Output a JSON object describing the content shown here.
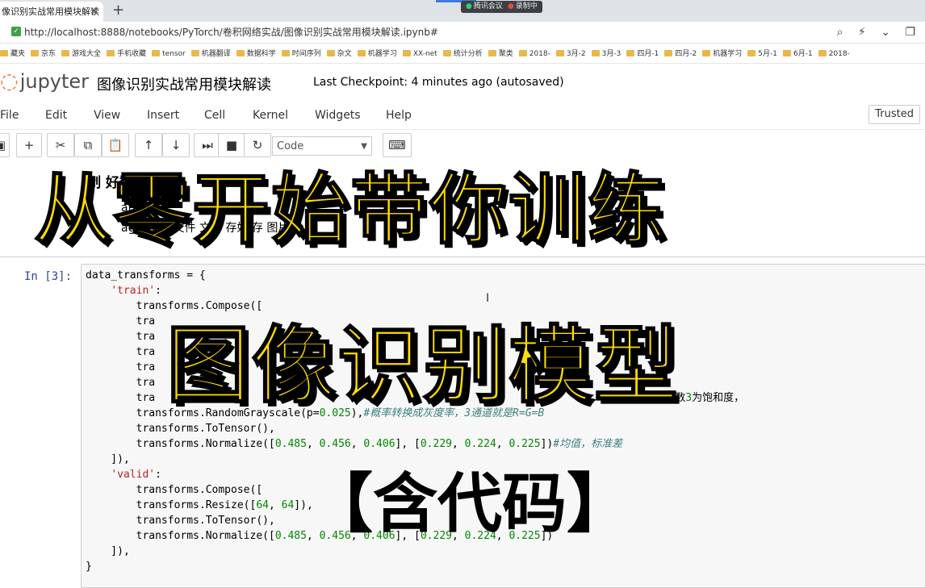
{
  "browser": {
    "tab_title": "像识别实战常用模块解读",
    "tab_close": "✕",
    "new_tab": "+",
    "meeting_label": "腾讯会议",
    "recording_label": "录制中",
    "url": "http://localhost:8888/notebooks/PyTorch/卷积网络实战/图像识别实战常用模块解读.ipynb#",
    "bookmarks": [
      "藏夹",
      "京东",
      "游戏大全",
      "手机收藏",
      "tensor",
      "机器翻译",
      "数据科学",
      "时间序列",
      "杂文",
      "机器学习",
      "XX-net",
      "统计分析",
      "聚类",
      "2018-",
      "3月-2",
      "3月-3",
      "四月-1",
      "四月-2",
      "机器学习",
      "5月-1",
      "6月-1",
      "2018-"
    ]
  },
  "jupyter": {
    "logo_text": "jupyter",
    "notebook_title": "图像识别实战常用模块解读",
    "checkpoint": "Last Checkpoint: 4 minutes ago (autosaved)",
    "menu": [
      "File",
      "Edit",
      "View",
      "Insert",
      "Cell",
      "Kernel",
      "Widgets",
      "Help"
    ],
    "trusted": "Trusted",
    "cell_type": "Code"
  },
  "markdown": {
    "heading": "制  好数",
    "line1": "ata_",
    "line2": "ageFol       的文件     文件 存好                              存              图片             分"
  },
  "cell": {
    "prompt": "In  [3]:",
    "code_lines": [
      [
        "data_transforms = {"
      ],
      [
        "    ",
        "'train'",
        ":"
      ],
      [
        "        transforms.Compose(["
      ],
      [
        "        tra"
      ],
      [
        "        tra"
      ],
      [
        "        tra"
      ],
      [
        "        tra"
      ],
      [
        "        tra"
      ],
      [
        "        tra                                                                          对比度，参数3为饱和度，"
      ],
      [
        "        transforms.RandomGrayscale(p=0.025),",
        "#概率转换成灰度率，3通道就是R=G=B"
      ],
      [
        "        transforms.ToTensor(),"
      ],
      [
        "        transforms.Normalize([0.485, 0.456, 0.406], [0.229, 0.224, 0.225])",
        "#均值，标准差"
      ],
      [
        "    ]),"
      ],
      [
        "    ",
        "'valid'",
        ":"
      ],
      [
        "        transforms.Compose(["
      ],
      [
        "        transforms.Resize([64, 64]),"
      ],
      [
        "        transforms.ToTensor(),"
      ],
      [
        "        transforms.Normalize([0.485, 0.456, 0.406], [0.229, 0.224, 0.225])"
      ],
      [
        "    ]),"
      ],
      [
        "}"
      ]
    ]
  },
  "overlay": {
    "line1": "从零开始带你训练",
    "line2": "图像识别模型",
    "line3": "【含代码】"
  }
}
